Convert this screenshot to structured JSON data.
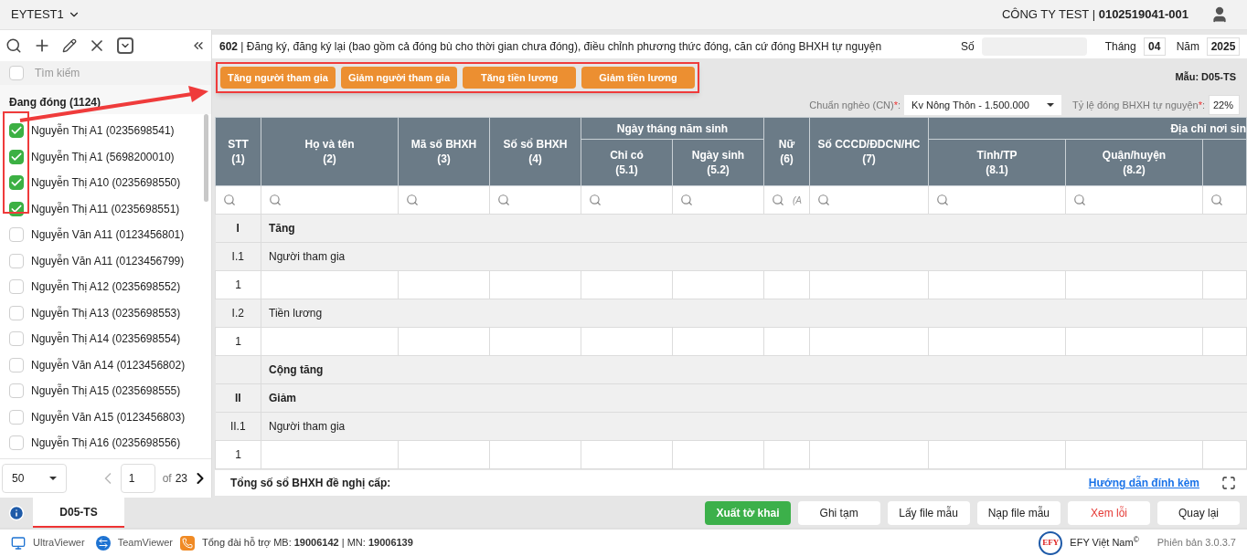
{
  "topbar": {
    "workspace": "EYTEST1",
    "company": "CÔNG TY TEST | **0102519041-001**"
  },
  "sidebar": {
    "search_placeholder": "Tìm kiếm",
    "search_checked": false,
    "group": "Đang đóng (1124)",
    "items": [
      {
        "label": "Nguyễn Thị A1 (0235698541)",
        "checked": true
      },
      {
        "label": "Nguyễn Thị A1 (5698200010)",
        "checked": true
      },
      {
        "label": "Nguyễn Thị A10 (0235698550)",
        "checked": true
      },
      {
        "label": "Nguyễn Thị A11 (0235698551)",
        "checked": true
      },
      {
        "label": "Nguyễn Văn A11 (0123456801)",
        "checked": false
      },
      {
        "label": "Nguyễn Văn A11 (0123456799)",
        "checked": false
      },
      {
        "label": "Nguyễn Thị A12 (0235698552)",
        "checked": false
      },
      {
        "label": "Nguyễn Thị A13 (0235698553)",
        "checked": false
      },
      {
        "label": "Nguyễn Thị A14 (0235698554)",
        "checked": false
      },
      {
        "label": "Nguyễn Văn A14 (0123456802)",
        "checked": false
      },
      {
        "label": "Nguyễn Thị A15 (0235698555)",
        "checked": false
      },
      {
        "label": "Nguyễn Văn A15 (0123456803)",
        "checked": false
      },
      {
        "label": "Nguyễn Thị A16 (0235698556)",
        "checked": false
      }
    ],
    "pagination": {
      "page_size": "50",
      "page": "1",
      "of": "of",
      "total": "23"
    }
  },
  "form": {
    "title": "**602** | Đăng ký, đăng ký lại (bao gồm cả đóng bù cho thời gian chưa đóng), điều chỉnh phương thức đóng, căn cứ đóng BHXH tự nguyện",
    "so_label": "Số",
    "month_label": "Tháng",
    "month": "04",
    "year_label": "Năm",
    "year": "2025",
    "actions": [
      "Tăng người tham gia",
      "Giảm người tham gia",
      "Tăng tiền lương",
      "Giảm tiền lương"
    ],
    "template": "Mẫu: D05-TS",
    "poverty_label": "Chuẩn nghèo (CN)",
    "poverty_mark": "*",
    "poverty_suffix": ":",
    "poverty_value": "Kv Nông Thôn - 1.500.000",
    "rate_label": "Tỷ lệ đóng BHXH tự nguyện",
    "rate_mark": "*",
    "rate_suffix": ":",
    "rate_value": "22%"
  },
  "table": {
    "header": [
      {
        "label": "STT",
        "number": "(1)"
      },
      {
        "label": "Họ và tên",
        "number": "(2)"
      },
      {
        "label": "Mã số BHXH",
        "number": "(3)"
      },
      {
        "label": "Số sổ BHXH",
        "number": "(4)"
      },
      {
        "group": "Ngày tháng năm sinh",
        "children": [
          {
            "label": "Chỉ có",
            "number": "(5.1)"
          },
          {
            "label": "Ngày sinh",
            "number": "(5.2)"
          }
        ]
      },
      {
        "label": "Nữ",
        "number": "(6)",
        "filter_hint": "(A"
      },
      {
        "label": "Số CCCD/ĐDCN/HC",
        "number": "(7)"
      },
      {
        "group": "Địa chỉ nơi sin",
        "children": [
          {
            "label": "Tỉnh/TP",
            "number": "(8.1)"
          },
          {
            "label": "Quận/huyện",
            "number": "(8.2)"
          }
        ]
      }
    ],
    "rows": [
      {
        "kind": "section",
        "stt": "I",
        "name": "Tăng"
      },
      {
        "kind": "subsection",
        "stt": "I.1",
        "name": "Người tham gia"
      },
      {
        "kind": "entry",
        "stt": "1"
      },
      {
        "kind": "subsection",
        "stt": "I.2",
        "name": "Tiền lương"
      },
      {
        "kind": "entry",
        "stt": "1"
      },
      {
        "kind": "total",
        "name": "Cộng tăng"
      },
      {
        "kind": "section",
        "stt": "II",
        "name": "Giảm"
      },
      {
        "kind": "subsection",
        "stt": "II.1",
        "name": "Người tham gia"
      },
      {
        "kind": "entry",
        "stt": "1"
      }
    ],
    "summary": "Tổng số sổ BHXH đề nghị cấp:",
    "guide_link": "Hướng dẫn đính kèm"
  },
  "tabs": [
    {
      "label": "D05-TS",
      "selected": true
    }
  ],
  "buttons": [
    {
      "label": "Xuất tờ khai",
      "kind": "primary"
    },
    {
      "label": "Ghi tạm",
      "kind": "default"
    },
    {
      "label": "Lấy file mẫu",
      "kind": "default"
    },
    {
      "label": "Nạp file mẫu",
      "kind": "default"
    },
    {
      "label": "Xem lỗi",
      "kind": "danger"
    },
    {
      "label": "Quay lại",
      "kind": "default"
    }
  ],
  "footer": {
    "links": [
      "UltraViewer",
      "TeamViewer"
    ],
    "hotline": "Tổng đài hỗ trợ MB: **19006142** | MN: **19006139**",
    "brand": "EFY Việt Nam",
    "logo_text": "EFY",
    "copyright": "©",
    "version": "Phiên bản 3.0.3.7"
  }
}
